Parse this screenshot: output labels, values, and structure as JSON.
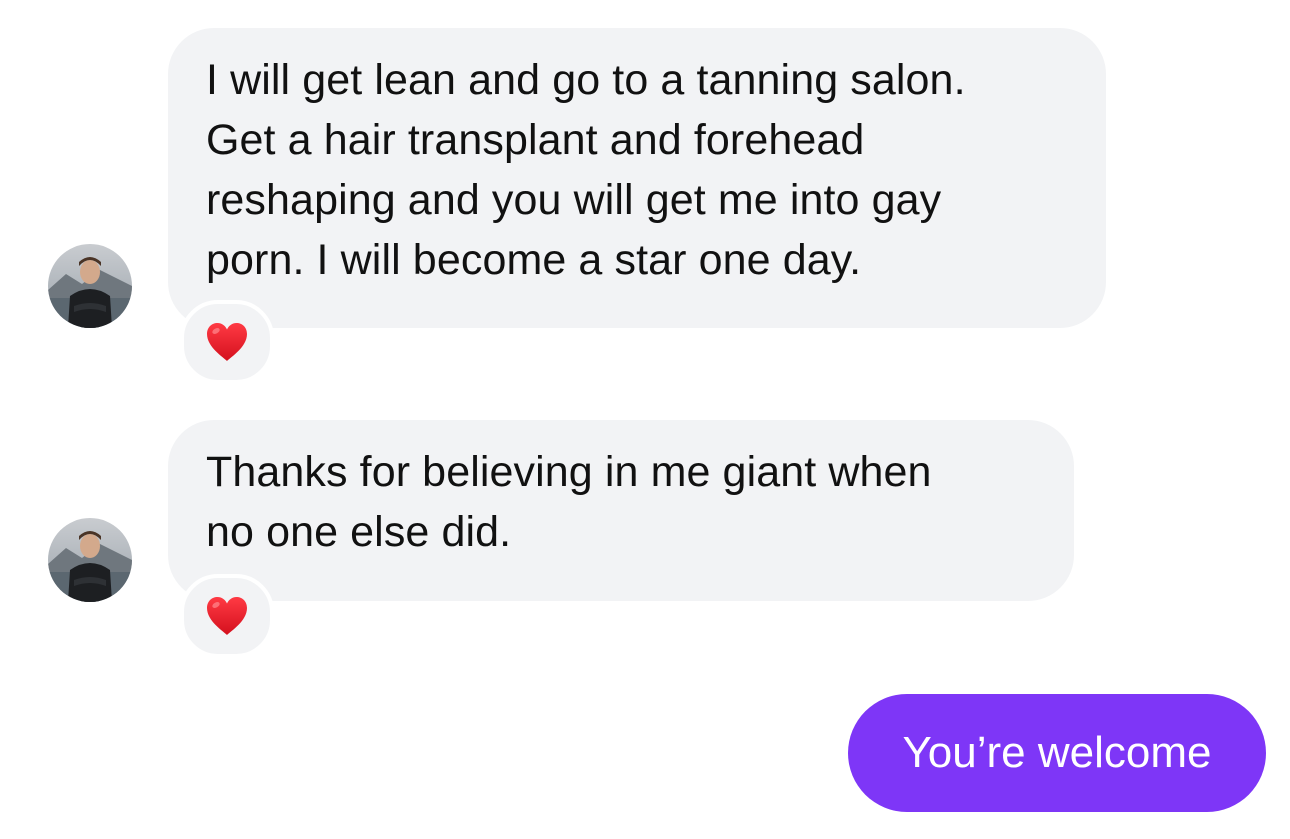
{
  "conversation": {
    "messages": [
      {
        "direction": "incoming",
        "lines": [
          "I will get lean and go to a tanning salon.",
          "Get a hair transplant and forehead",
          "reshaping and you will get me into gay",
          "porn. I will become a star one day."
        ],
        "reaction": "heart",
        "avatar_icon": "user-avatar-photo"
      },
      {
        "direction": "incoming",
        "lines": [
          "Thanks for believing in me giant when",
          "no one else did."
        ],
        "reaction": "heart",
        "avatar_icon": "user-avatar-photo"
      },
      {
        "direction": "outgoing",
        "text": "You’re welcome"
      }
    ]
  },
  "colors": {
    "incoming_bubble": "#f2f3f5",
    "outgoing_bubble": "#7e36f7",
    "heart": "#e8202c",
    "text": "#111111"
  }
}
